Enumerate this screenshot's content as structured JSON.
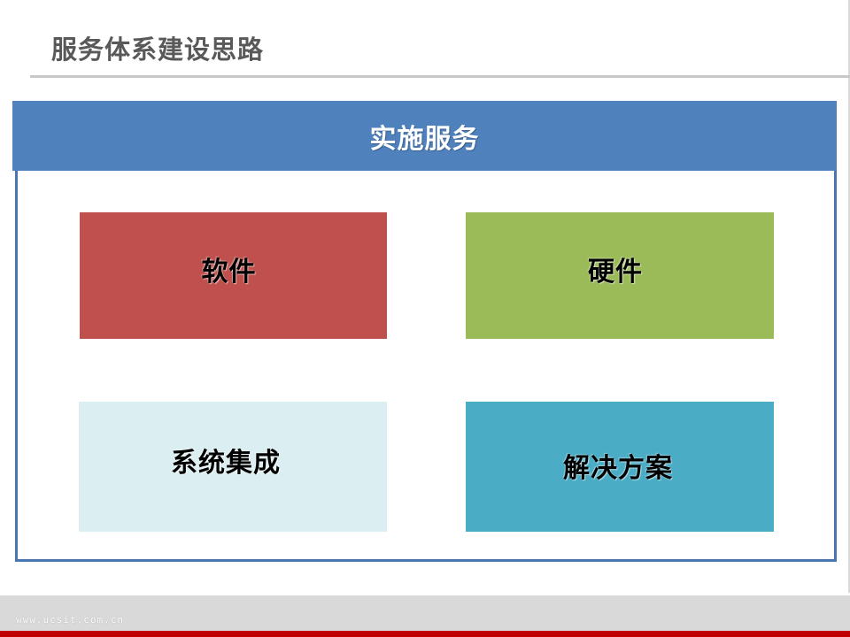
{
  "slide": {
    "title": "服务体系建设思路"
  },
  "panel": {
    "header": "实施服务",
    "cards": [
      {
        "label": "软件",
        "color": "#c0504d"
      },
      {
        "label": "硬件",
        "color": "#9bbb59"
      },
      {
        "label": "系统集成",
        "color": "#dbeef1"
      },
      {
        "label": "解决方案",
        "color": "#4bacc6"
      }
    ],
    "header_color": "#4f81bd"
  },
  "footer": {
    "url": "www.ucsit.com.cn",
    "accent_color": "#c00000"
  }
}
